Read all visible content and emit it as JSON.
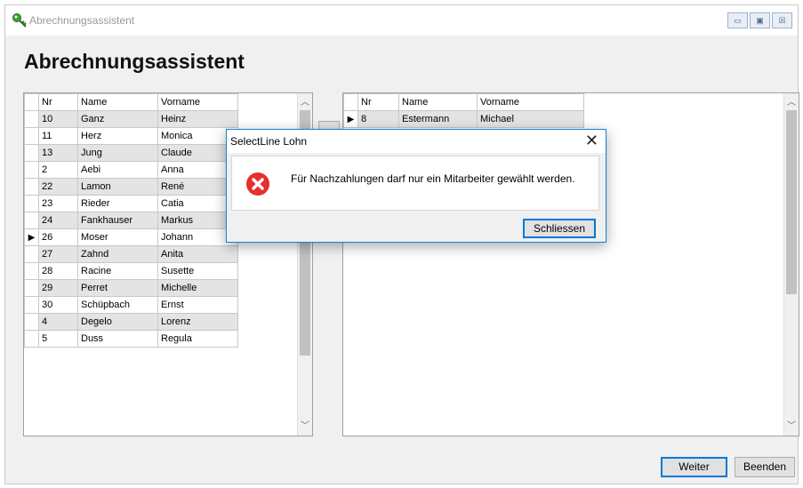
{
  "window": {
    "title": "Abrechnungsassistent",
    "controls": {
      "minimize": "▭",
      "restore": "▣",
      "close": "☒"
    }
  },
  "page": {
    "heading": "Abrechnungsassistent"
  },
  "left_grid": {
    "columns": [
      "Nr",
      "Name",
      "Vorname"
    ],
    "rows": [
      {
        "nr": "10",
        "name": "Ganz",
        "vorname": "Heinz",
        "marker": ""
      },
      {
        "nr": "11",
        "name": "Herz",
        "vorname": "Monica",
        "marker": ""
      },
      {
        "nr": "13",
        "name": "Jung",
        "vorname": "Claude",
        "marker": ""
      },
      {
        "nr": "2",
        "name": "Aebi",
        "vorname": "Anna",
        "marker": ""
      },
      {
        "nr": "22",
        "name": "Lamon",
        "vorname": "René",
        "marker": ""
      },
      {
        "nr": "23",
        "name": "Rieder",
        "vorname": "Catia",
        "marker": ""
      },
      {
        "nr": "24",
        "name": "Fankhauser",
        "vorname": "Markus",
        "marker": ""
      },
      {
        "nr": "26",
        "name": "Moser",
        "vorname": "Johann",
        "marker": "▶"
      },
      {
        "nr": "27",
        "name": "Zahnd",
        "vorname": "Anita",
        "marker": ""
      },
      {
        "nr": "28",
        "name": "Racine",
        "vorname": "Susette",
        "marker": ""
      },
      {
        "nr": "29",
        "name": "Perret",
        "vorname": "Michelle",
        "marker": ""
      },
      {
        "nr": "30",
        "name": "Schüpbach",
        "vorname": "Ernst",
        "marker": ""
      },
      {
        "nr": "4",
        "name": "Degelo",
        "vorname": "Lorenz",
        "marker": ""
      },
      {
        "nr": "5",
        "name": "Duss",
        "vorname": "Regula",
        "marker": ""
      }
    ],
    "scroll_up": "︿",
    "scroll_down": "﹀"
  },
  "right_grid": {
    "columns": [
      "Nr",
      "Name",
      "Vorname"
    ],
    "rows": [
      {
        "nr": "8",
        "name": "Estermann",
        "vorname": "Michael",
        "marker": "▶"
      }
    ],
    "scroll_up": "︿",
    "scroll_down": "﹀"
  },
  "dialog": {
    "title": "SelectLine Lohn",
    "close_glyph": "✕",
    "message": "Für Nachzahlungen darf nur ein Mitarbeiter gewählt werden.",
    "button": "Schliessen",
    "icon": "error-icon"
  },
  "footer": {
    "next_button": "Weiter",
    "quit_button": "Beenden"
  },
  "colors": {
    "accent": "#0078d7",
    "error": "#e81123",
    "row_alt": "#e4e4e4"
  }
}
